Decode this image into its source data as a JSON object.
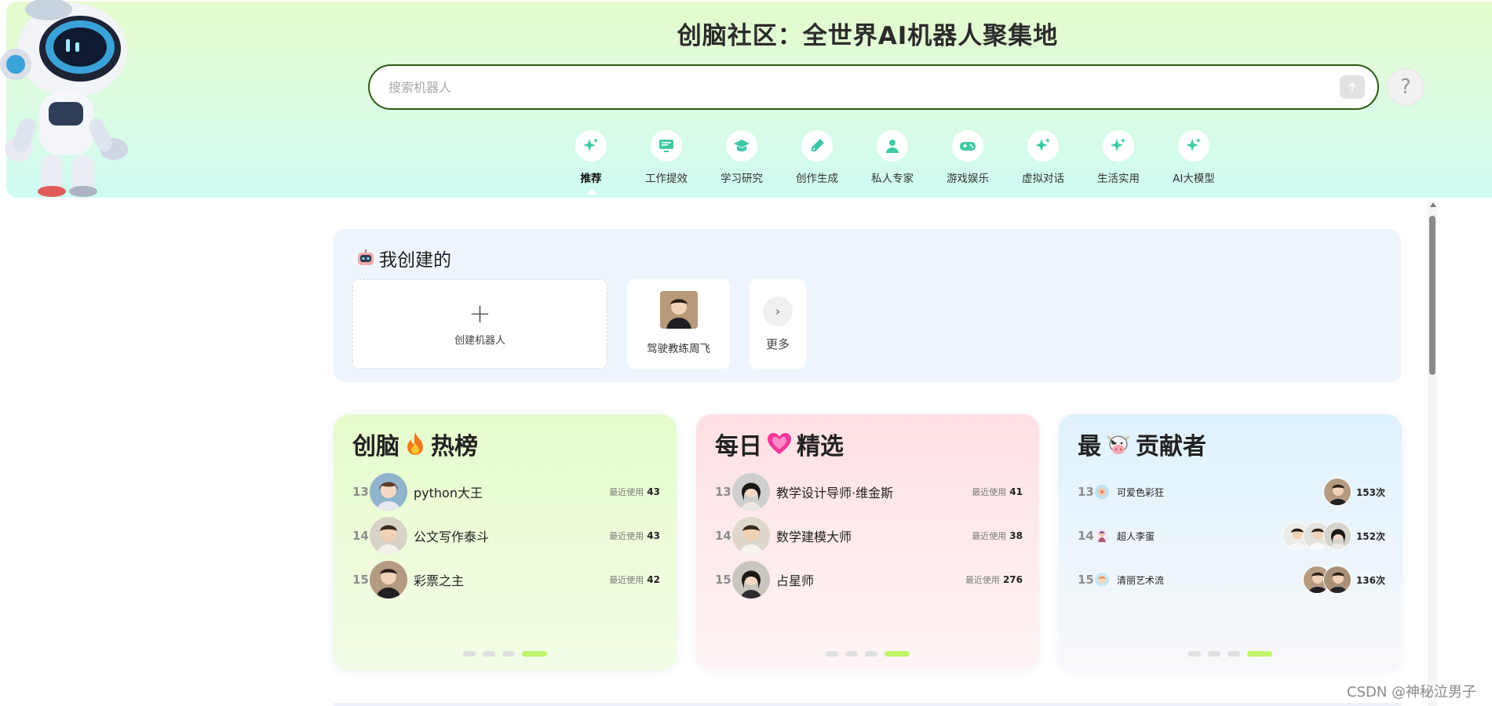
{
  "header": {
    "title": "创脑社区：全世界AI机器人聚集地",
    "search_placeholder": "搜索机器人",
    "help_label": "?"
  },
  "categories": [
    {
      "label": "推荐",
      "icon": "sparkle-icon",
      "active": true
    },
    {
      "label": "工作提效",
      "icon": "monitor-icon"
    },
    {
      "label": "学习研究",
      "icon": "graduation-cap-icon"
    },
    {
      "label": "创作生成",
      "icon": "pen-icon"
    },
    {
      "label": "私人专家",
      "icon": "person-icon"
    },
    {
      "label": "游戏娱乐",
      "icon": "gamepad-icon"
    },
    {
      "label": "虚拟对话",
      "icon": "sparkle-icon"
    },
    {
      "label": "生活实用",
      "icon": "sparkle-icon"
    },
    {
      "label": "AI大模型",
      "icon": "sparkle-icon"
    }
  ],
  "mine": {
    "title": "我创建的",
    "create_label": "创建机器人",
    "bots": [
      {
        "name": "驾驶教练周飞"
      }
    ],
    "more_label": "更多"
  },
  "hot": {
    "title_left": "创脑",
    "title_right": "热榜",
    "rows": [
      {
        "rank": "13",
        "name": "python大王",
        "usage_label": "最近使用",
        "usage": "43"
      },
      {
        "rank": "14",
        "name": "公文写作泰斗",
        "usage_label": "最近使用",
        "usage": "43"
      },
      {
        "rank": "15",
        "name": "彩票之主",
        "usage_label": "最近使用",
        "usage": "42"
      }
    ]
  },
  "daily": {
    "title_left": "每日",
    "title_right": "精选",
    "rows": [
      {
        "rank": "13",
        "name": "教学设计导师·维金斯",
        "usage_label": "最近使用",
        "usage": "41"
      },
      {
        "rank": "14",
        "name": "数学建模大师",
        "usage_label": "最近使用",
        "usage": "38"
      },
      {
        "rank": "15",
        "name": "占星师",
        "usage_label": "最近使用",
        "usage": "276"
      }
    ]
  },
  "contrib": {
    "title_left": "最",
    "title_right": "贡献者",
    "rows": [
      {
        "rank": "13",
        "name": "可爱色彩狂",
        "times": "153次"
      },
      {
        "rank": "14",
        "name": "超人李蛋",
        "times": "152次"
      },
      {
        "rank": "15",
        "name": "清丽艺术流",
        "times": "136次"
      }
    ]
  },
  "watermark": "CSDN @神秘泣男子",
  "colors": {
    "accent": "#bff46a",
    "search_border": "#2e5b12"
  }
}
